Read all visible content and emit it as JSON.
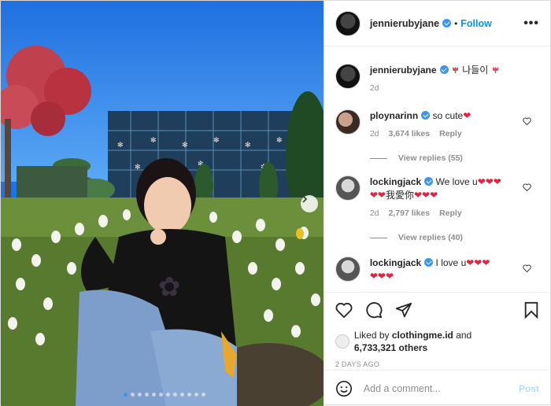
{
  "header": {
    "username": "jennierubyjane",
    "separator": "•",
    "follow_label": "Follow",
    "more_icon": "more-horizontal-icon"
  },
  "caption": {
    "username": "jennierubyjane",
    "text": "나들이",
    "time": "2d"
  },
  "comments": [
    {
      "username": "ploynarinn",
      "text": "so cute",
      "time": "2d",
      "likes": "3,674 likes",
      "reply_label": "Reply",
      "view_replies": "View replies (55)"
    },
    {
      "username": "lockingjack",
      "text": "We love u",
      "text2": "我愛你",
      "time": "2d",
      "likes": "2,797 likes",
      "reply_label": "Reply",
      "view_replies": "View replies (40)"
    },
    {
      "username": "lockingjack",
      "text": "I love u"
    }
  ],
  "actions": {
    "liked_prefix": "Liked by ",
    "liked_user": "clothingme.id",
    "liked_and": " and",
    "others": "6,733,321 others",
    "date": "2 DAYS AGO"
  },
  "add_comment": {
    "placeholder": "Add a comment...",
    "post_label": "Post"
  },
  "colors": {
    "accent": "#0095f6",
    "verified": "#3897f0",
    "heart_emoji": "#e8203c",
    "muted": "#8e8e8e"
  },
  "carousel": {
    "total_slides": 12,
    "active_slide": 1
  }
}
